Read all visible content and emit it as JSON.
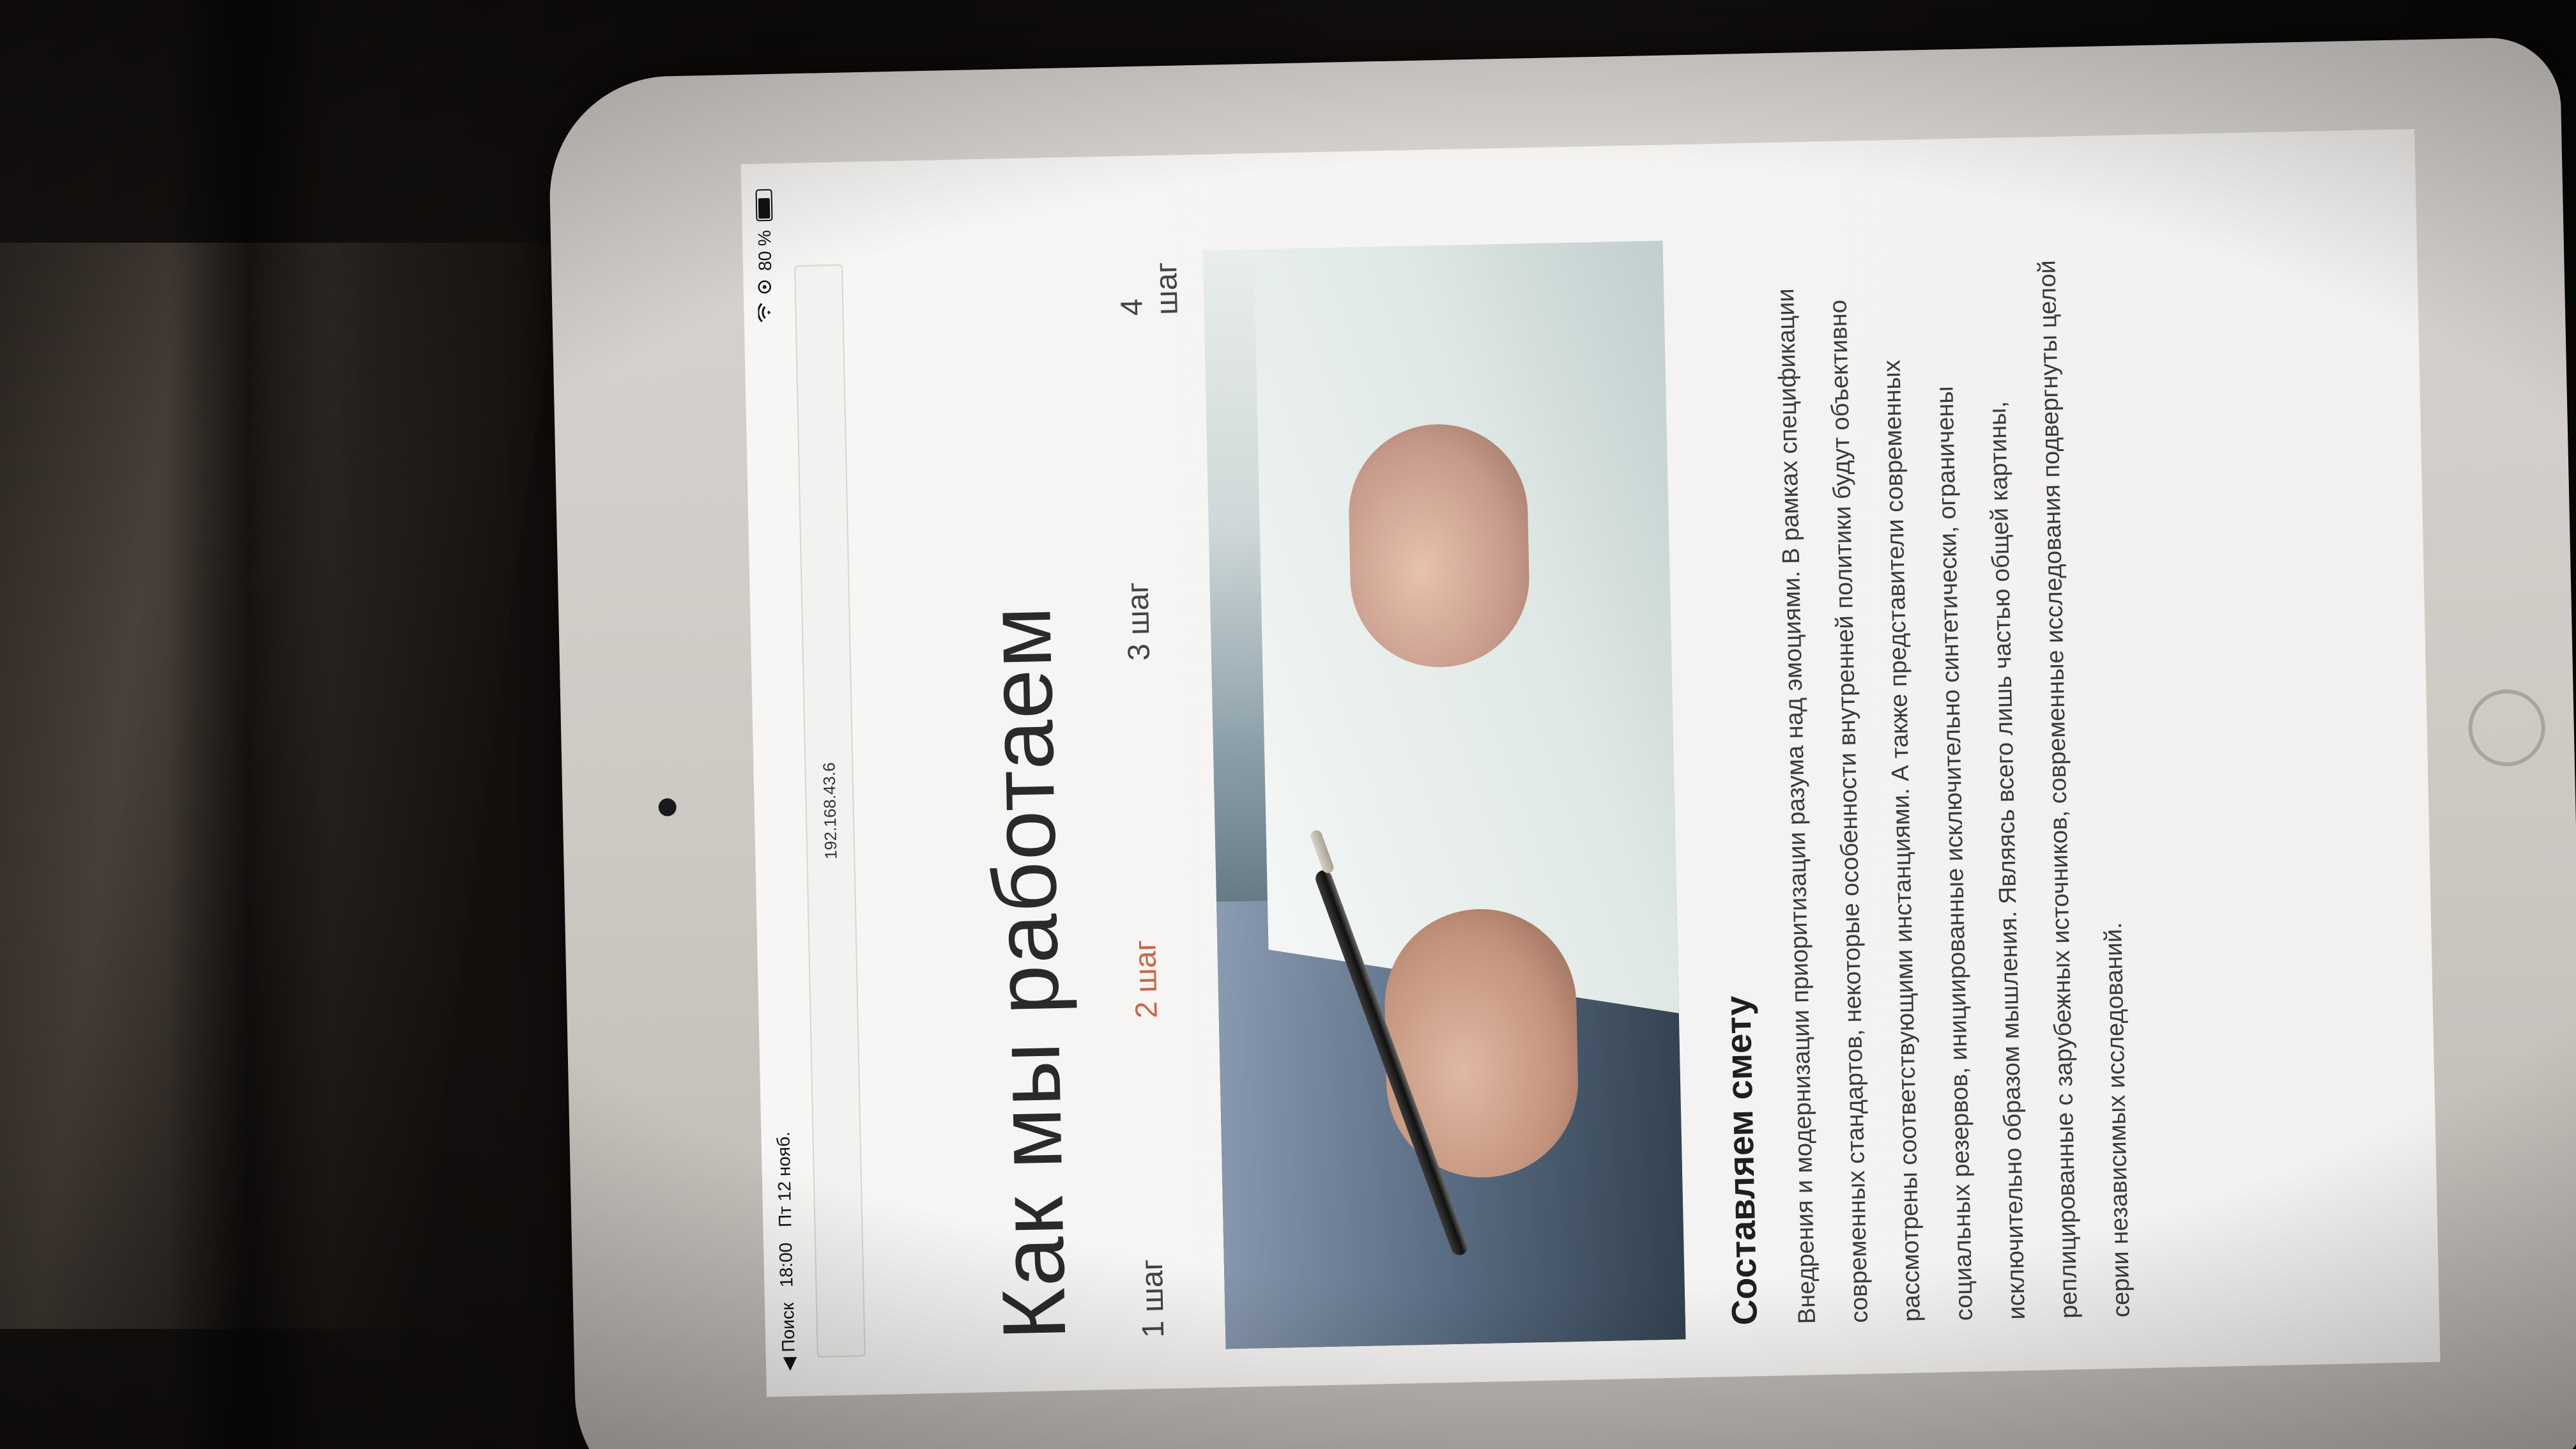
{
  "status_bar": {
    "back_label": "◀ Поиск",
    "time": "18:00",
    "date": "Пт 12 нояб.",
    "battery": "80 %",
    "battery_level": 0.8
  },
  "browser": {
    "url": "192.168.43.6"
  },
  "page": {
    "title": "Как мы работаем",
    "steps": [
      {
        "label": "1 шаг",
        "active": false
      },
      {
        "label": "2 шаг",
        "active": true
      },
      {
        "label": "3 шаг",
        "active": false
      },
      {
        "label": "4 шаг",
        "active": false
      }
    ],
    "section_heading": "Составляем смету",
    "body_text": "Внедрения и модернизации приоритизации разума над эмоциями. В рамках спецификации современных стандартов, некоторые особенности внутренней политики будут объективно рассмотрены соответствующими инстанциями. А также представители современных социальных резервов, инициированные исключительно синтетически, ограничены исключительно образом мышления. Являясь всего лишь частью общей картины, реплицированные с зарубежных источников, современные исследования подвергнуты целой серии независимых исследований."
  },
  "colors": {
    "accent": "#c9674a",
    "text": "#2a2a2a",
    "background": "#f4f3f1"
  }
}
